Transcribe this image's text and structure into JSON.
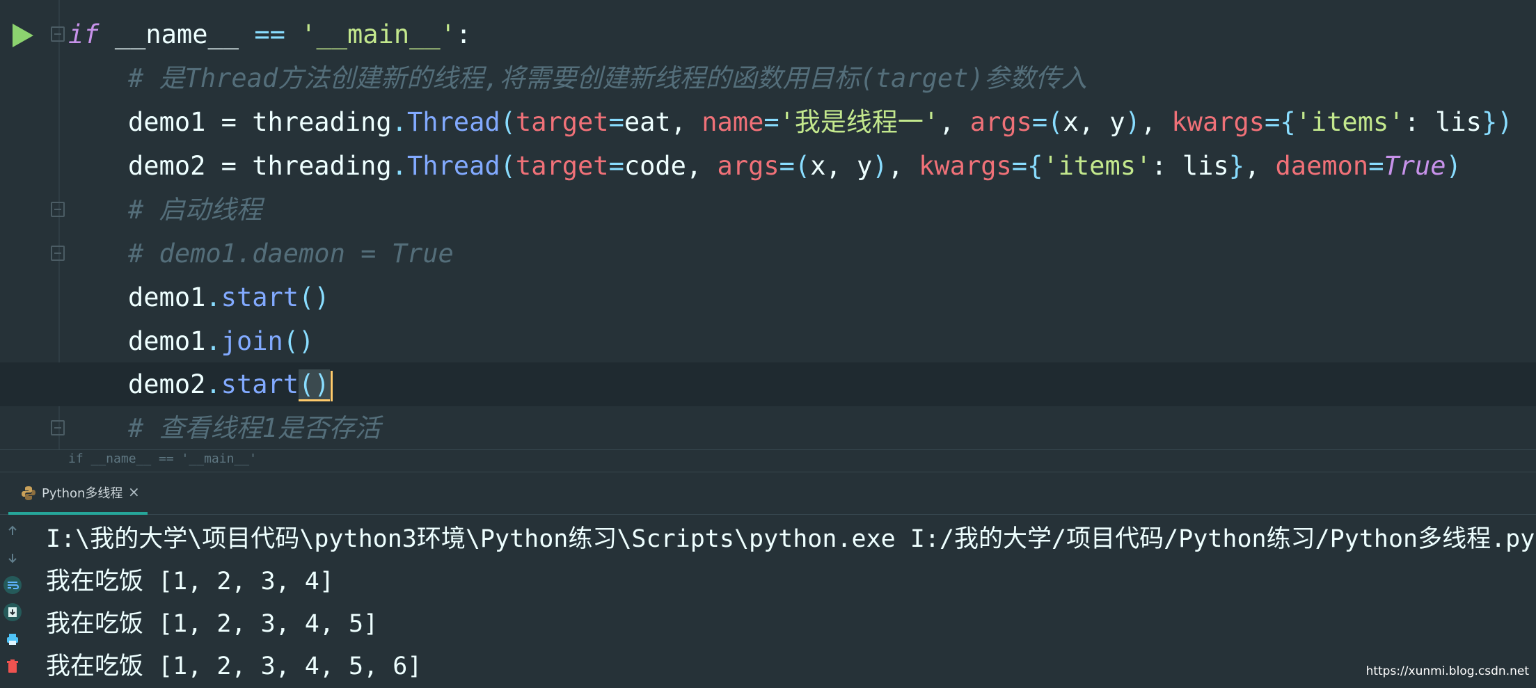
{
  "editor": {
    "lines": [
      {
        "id": "l1",
        "segments": [
          [
            "kw-it",
            "if"
          ],
          [
            "plain",
            " __name__ "
          ],
          [
            "op",
            "=="
          ],
          [
            "plain",
            " "
          ],
          [
            "str",
            "'__main__'"
          ],
          [
            "plain",
            ":"
          ]
        ]
      },
      {
        "id": "l2",
        "segments": [
          [
            "cmt",
            "# 是Thread方法创建新的线程,将需要创建新线程的函数用目标(target)参数传入"
          ]
        ]
      },
      {
        "id": "l3",
        "segments": [
          [
            "plain",
            "demo1 = threading"
          ],
          [
            "op",
            "."
          ],
          [
            "fn",
            "Thread"
          ],
          [
            "op",
            "("
          ],
          [
            "param",
            "target"
          ],
          [
            "op",
            "="
          ],
          [
            "plain",
            "eat, "
          ],
          [
            "param",
            "name"
          ],
          [
            "op",
            "="
          ],
          [
            "str",
            "'我是线程一'"
          ],
          [
            "plain",
            ", "
          ],
          [
            "param",
            "args"
          ],
          [
            "op",
            "=("
          ],
          [
            "plain",
            "x, y"
          ],
          [
            "op",
            ")"
          ],
          [
            "plain",
            ", "
          ],
          [
            "param",
            "kwargs"
          ],
          [
            "op",
            "={"
          ],
          [
            "str",
            "'items'"
          ],
          [
            "plain",
            ": lis"
          ],
          [
            "op",
            "})"
          ]
        ]
      },
      {
        "id": "l4",
        "segments": [
          [
            "plain",
            "demo2 = threading"
          ],
          [
            "op",
            "."
          ],
          [
            "fn",
            "Thread"
          ],
          [
            "op",
            "("
          ],
          [
            "param",
            "target"
          ],
          [
            "op",
            "="
          ],
          [
            "plain",
            "code, "
          ],
          [
            "param",
            "args"
          ],
          [
            "op",
            "=("
          ],
          [
            "plain",
            "x, y"
          ],
          [
            "op",
            ")"
          ],
          [
            "plain",
            ", "
          ],
          [
            "param",
            "kwargs"
          ],
          [
            "op",
            "={"
          ],
          [
            "str",
            "'items'"
          ],
          [
            "plain",
            ": lis"
          ],
          [
            "op",
            "}"
          ],
          [
            "plain",
            ", "
          ],
          [
            "param",
            "daemon"
          ],
          [
            "op",
            "="
          ],
          [
            "kw-it",
            "True"
          ],
          [
            "op",
            ")"
          ]
        ]
      },
      {
        "id": "l5",
        "segments": [
          [
            "cmt",
            "# 启动线程"
          ]
        ]
      },
      {
        "id": "l6",
        "segments": [
          [
            "cmt",
            "# demo1.daemon = True"
          ]
        ]
      },
      {
        "id": "l7",
        "segments": [
          [
            "plain",
            "demo1"
          ],
          [
            "op",
            "."
          ],
          [
            "fn",
            "start"
          ],
          [
            "op",
            "()"
          ]
        ]
      },
      {
        "id": "l8",
        "segments": [
          [
            "plain",
            "demo1"
          ],
          [
            "op",
            "."
          ],
          [
            "fn",
            "join"
          ],
          [
            "op",
            "()"
          ]
        ]
      },
      {
        "id": "l9",
        "segments": [
          [
            "plain",
            "demo2"
          ],
          [
            "op",
            "."
          ],
          [
            "fn",
            "start"
          ],
          [
            "caret",
            "()"
          ]
        ]
      },
      {
        "id": "l10",
        "segments": [
          [
            "cmt",
            "# 查看线程1是否存活"
          ]
        ]
      }
    ]
  },
  "breadcrumb": "if __name__ == '__main__'",
  "run_tab": {
    "label": "Python多线程",
    "close": "×"
  },
  "console": {
    "lines": [
      "I:\\我的大学\\项目代码\\python3环境\\Python练习\\Scripts\\python.exe I:/我的大学/项目代码/Python练习/Python多线程.py",
      "我在吃饭 [1, 2, 3, 4]",
      "我在吃饭 [1, 2, 3, 4, 5]",
      "我在吃饭 [1, 2, 3, 4, 5, 6]"
    ]
  },
  "watermark": "https://xunmi.blog.csdn.net",
  "colors": {
    "background": "#263238",
    "keyword": "#c792ea",
    "string": "#c3e88d",
    "param": "#f07178",
    "function": "#82aaff",
    "comment": "#546e7a",
    "accent": "#26a69a"
  },
  "icons": [
    "run-icon",
    "fold-icon",
    "python-icon",
    "arrow-up-icon",
    "arrow-down-icon",
    "soft-wrap-icon",
    "scroll-to-end-icon",
    "print-icon",
    "trash-icon"
  ]
}
